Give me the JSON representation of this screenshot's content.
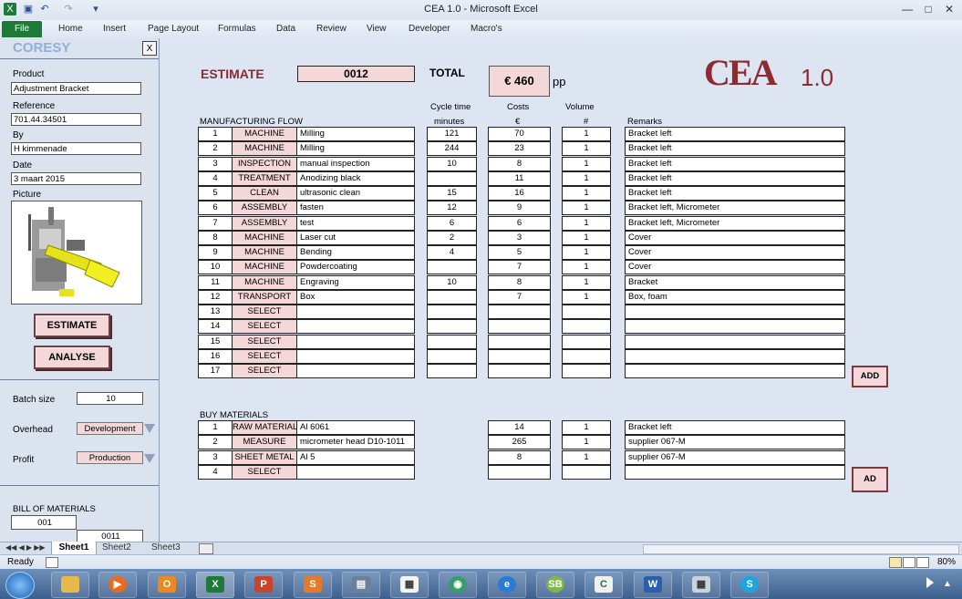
{
  "window": {
    "title": "CEA 1.0  -  Microsoft Excel"
  },
  "ribbon": {
    "file": "File",
    "tabs": [
      "Home",
      "Insert",
      "Page Layout",
      "Formulas",
      "Data",
      "Review",
      "View",
      "Developer",
      "Macro's"
    ]
  },
  "panel": {
    "brand": "CORESY",
    "close": "X",
    "product_label": "Product",
    "product_value": "Adjustment Bracket",
    "reference_label": "Reference",
    "reference_value": "701.44.34501",
    "by_label": "By",
    "by_value": "H kimmenade",
    "date_label": "Date",
    "date_value": "3 maart 2015",
    "picture_label": "Picture",
    "estimate_button": "ESTIMATE",
    "analyse_button": "ANALYSE",
    "batch_label": "Batch size",
    "batch_value": "10",
    "overhead_label": "Overhead",
    "overhead_value": "Development",
    "profit_label": "Profit",
    "profit_value": "Production",
    "bom_label": "BILL OF MATERIALS",
    "bom_items": [
      "001",
      "0011"
    ]
  },
  "sheet": {
    "estimate_label": "ESTIMATE",
    "estimate_number": "0012",
    "total_label": "TOTAL",
    "total_value": "€ 460",
    "total_unit": "pp",
    "logo_text": "CEA",
    "logo_version": "1.0",
    "mf_title": "MANUFACTURING FLOW",
    "col_cycle_1": "Cycle time",
    "col_cycle_2": "minutes",
    "col_costs_1": "Costs",
    "col_costs_2": "€",
    "col_volume_1": "Volume",
    "col_volume_2": "#",
    "col_remarks": "Remarks",
    "flow_rows": [
      {
        "n": "1",
        "type": "MACHINE",
        "desc": "Milling",
        "cycle": "121",
        "cost": "70",
        "vol": "1",
        "remark": "Bracket left"
      },
      {
        "n": "2",
        "type": "MACHINE",
        "desc": "Milling",
        "cycle": "244",
        "cost": "23",
        "vol": "1",
        "remark": "Bracket left"
      },
      {
        "n": "3",
        "type": "INSPECTION",
        "desc": "manual inspection",
        "cycle": "10",
        "cost": "8",
        "vol": "1",
        "remark": "Bracket left"
      },
      {
        "n": "4",
        "type": "TREATMENT",
        "desc": "Anodizing black",
        "cycle": "",
        "cost": "11",
        "vol": "1",
        "remark": "Bracket left"
      },
      {
        "n": "5",
        "type": "CLEAN",
        "desc": "ultrasonic clean",
        "cycle": "15",
        "cost": "16",
        "vol": "1",
        "remark": "Bracket left"
      },
      {
        "n": "6",
        "type": "ASSEMBLY",
        "desc": "fasten",
        "cycle": "12",
        "cost": "9",
        "vol": "1",
        "remark": "Bracket left, Micrometer"
      },
      {
        "n": "7",
        "type": "ASSEMBLY",
        "desc": "test",
        "cycle": "6",
        "cost": "6",
        "vol": "1",
        "remark": "Bracket left, Micrometer"
      },
      {
        "n": "8",
        "type": "MACHINE",
        "desc": "Laser cut",
        "cycle": "2",
        "cost": "3",
        "vol": "1",
        "remark": "Cover"
      },
      {
        "n": "9",
        "type": "MACHINE",
        "desc": "Bending",
        "cycle": "4",
        "cost": "5",
        "vol": "1",
        "remark": "Cover"
      },
      {
        "n": "10",
        "type": "MACHINE",
        "desc": "Powdercoating",
        "cycle": "",
        "cost": "7",
        "vol": "1",
        "remark": "Cover"
      },
      {
        "n": "11",
        "type": "MACHINE",
        "desc": "Engraving",
        "cycle": "10",
        "cost": "8",
        "vol": "1",
        "remark": "Bracket"
      },
      {
        "n": "12",
        "type": "TRANSPORT",
        "desc": "Box",
        "cycle": "",
        "cost": "7",
        "vol": "1",
        "remark": "Box, foam"
      },
      {
        "n": "13",
        "type": "SELECT",
        "desc": "",
        "cycle": "",
        "cost": "",
        "vol": "",
        "remark": ""
      },
      {
        "n": "14",
        "type": "SELECT",
        "desc": "",
        "cycle": "",
        "cost": "",
        "vol": "",
        "remark": ""
      },
      {
        "n": "15",
        "type": "SELECT",
        "desc": "",
        "cycle": "",
        "cost": "",
        "vol": "",
        "remark": ""
      },
      {
        "n": "16",
        "type": "SELECT",
        "desc": "",
        "cycle": "",
        "cost": "",
        "vol": "",
        "remark": ""
      },
      {
        "n": "17",
        "type": "SELECT",
        "desc": "",
        "cycle": "",
        "cost": "",
        "vol": "",
        "remark": ""
      }
    ],
    "add_flow_button": "ADD",
    "bm_title": "BUY MATERIALS",
    "buy_rows": [
      {
        "n": "1",
        "type": "RAW MATERIAL",
        "desc": "Al 6061",
        "cost": "14",
        "vol": "1",
        "remark": "Bracket left"
      },
      {
        "n": "2",
        "type": "MEASURE",
        "desc": "micrometer head D10-1011",
        "cost": "265",
        "vol": "1",
        "remark": "supplier 067-M"
      },
      {
        "n": "3",
        "type": "SHEET METAL",
        "desc": "Al 5",
        "cost": "8",
        "vol": "1",
        "remark": "supplier 067-M"
      },
      {
        "n": "4",
        "type": "SELECT",
        "desc": "",
        "cost": "",
        "vol": "",
        "remark": ""
      }
    ],
    "add_buy_button": "AD"
  },
  "sheet_tabs": [
    "Sheet1",
    "Sheet2",
    "Sheet3"
  ],
  "status": {
    "ready": "Ready",
    "zoom": "80%"
  },
  "taskbar_apps": [
    "start",
    "explorer",
    "media",
    "outlook",
    "excel",
    "powerpoint",
    "slides",
    "files",
    "calendar",
    "browser",
    "ie",
    "sb",
    "c-app",
    "word",
    "calculator",
    "skype"
  ]
}
